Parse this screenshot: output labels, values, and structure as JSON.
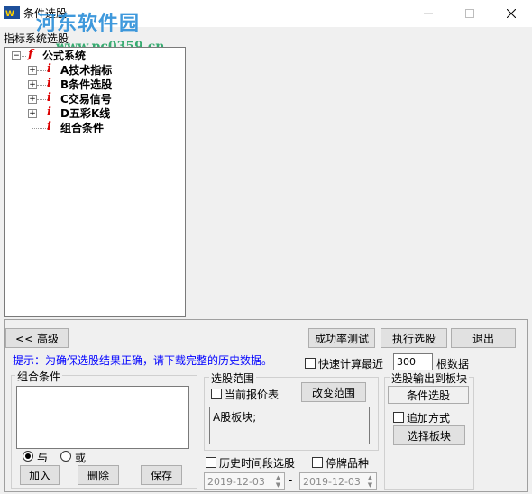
{
  "window": {
    "title": "条件选股"
  },
  "watermark": {
    "logo_text": "河东软件园",
    "url": "www.pc0359.cn"
  },
  "tree": {
    "group_label": "指标系统选股",
    "root": "公式系统",
    "items": [
      "A技术指标",
      "B条件选股",
      "C交易信号",
      "D五彩K线",
      "组合条件"
    ]
  },
  "buttons": {
    "advanced": "<< 高级",
    "success_test": "成功率测试",
    "execute": "执行选股",
    "exit": "退出",
    "change_range": "改变范围",
    "output_block": "条件选股",
    "select_block": "选择板块",
    "add": "加入",
    "delete": "删除",
    "save": "保存"
  },
  "hint": "提示：为确保选股结果正确，请下载完整的历史数据。",
  "quick_calc": {
    "label": "快速计算最近",
    "value": "300",
    "suffix": "根数据"
  },
  "combo": {
    "title": "组合条件",
    "and": "与",
    "or": "或"
  },
  "range": {
    "title": "选股范围",
    "current_quote": "当前报价表",
    "content": "A股板块;"
  },
  "output": {
    "title": "选股输出到板块",
    "append": "追加方式"
  },
  "history": {
    "label": "历史时间段选股",
    "suspended": "停牌品种",
    "start": "2019-12-03",
    "end": "2019-12-03",
    "dash": "-"
  }
}
